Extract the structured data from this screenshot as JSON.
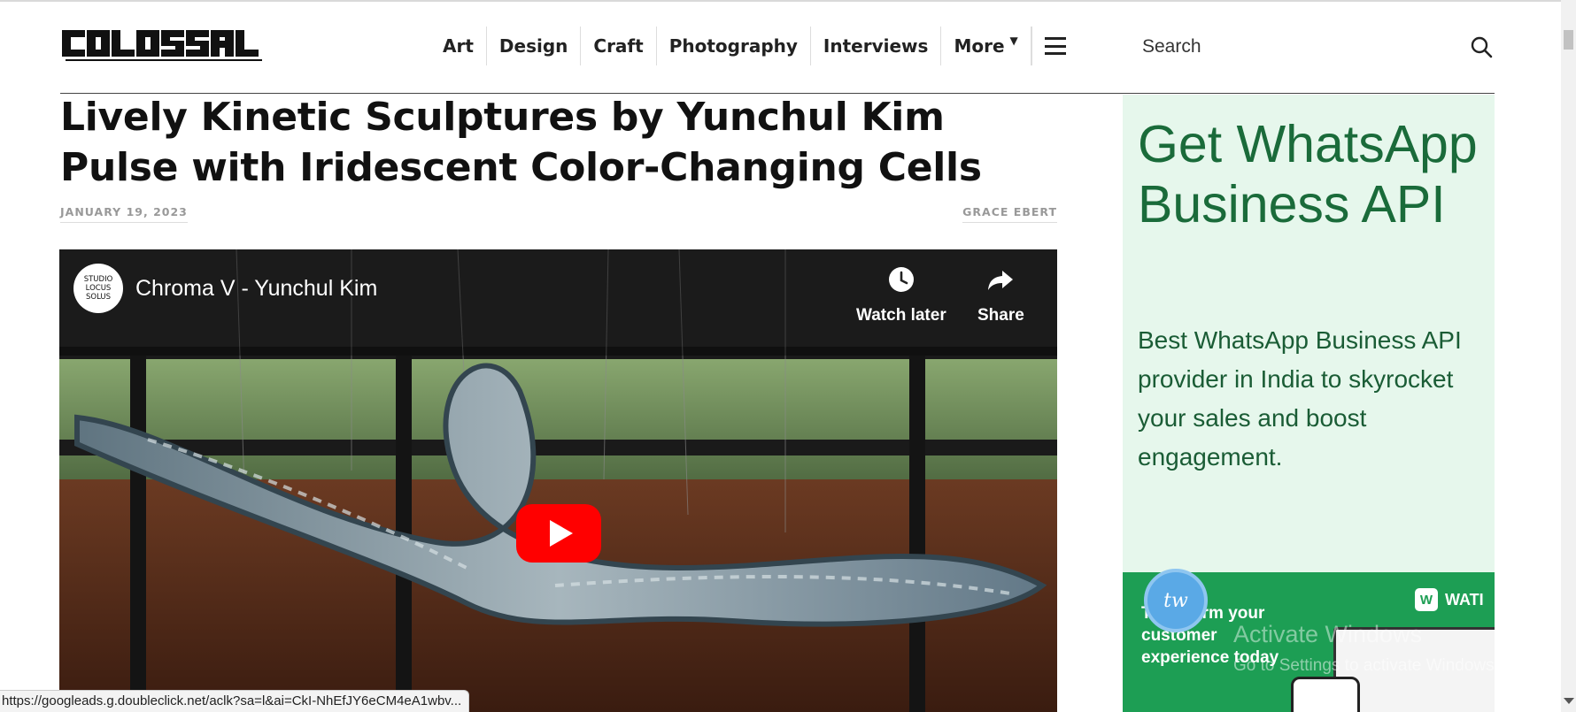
{
  "site": {
    "logo_text": "COLOSSAL"
  },
  "nav": {
    "items": [
      "Art",
      "Design",
      "Craft",
      "Photography",
      "Interviews"
    ],
    "more_label": "More",
    "menu_icon": "hamburger-icon"
  },
  "search": {
    "placeholder": "Search",
    "icon": "search-icon"
  },
  "article": {
    "title": "Lively Kinetic Sculptures by Yunchul Kim Pulse with Iridescent Color-Changing Cells",
    "date": "JANUARY 19, 2023",
    "author": "GRACE EBERT"
  },
  "video": {
    "channel_logo_lines": [
      "STUDIO",
      "LOCUS",
      "SOLUS"
    ],
    "title": "Chroma V - Yunchul Kim",
    "watch_later_label": "Watch later",
    "share_label": "Share",
    "play_icon": "play-icon"
  },
  "ad": {
    "headline": "Get WhatsApp Business API",
    "body": "Best WhatsApp Business API provider in India to skyrocket your sales and boost engagement.",
    "banner_text": "Transform your customer experience today",
    "banner_brand": "WATI"
  },
  "chat_widget": {
    "label": "tw"
  },
  "watermark": {
    "line1": "Activate Windows",
    "line2": "Go to Settings to activate Windows."
  },
  "status_bar": {
    "url": "https://googleads.g.doubleclick.net/aclk?sa=l&ai=CkI-NhEfJY6eCM4eA1wbv..."
  },
  "colors": {
    "ad_background": "#e6f7ec",
    "ad_text": "#1a6b3a",
    "ad_banner": "#1d9e54",
    "play_button": "#ff0000"
  }
}
